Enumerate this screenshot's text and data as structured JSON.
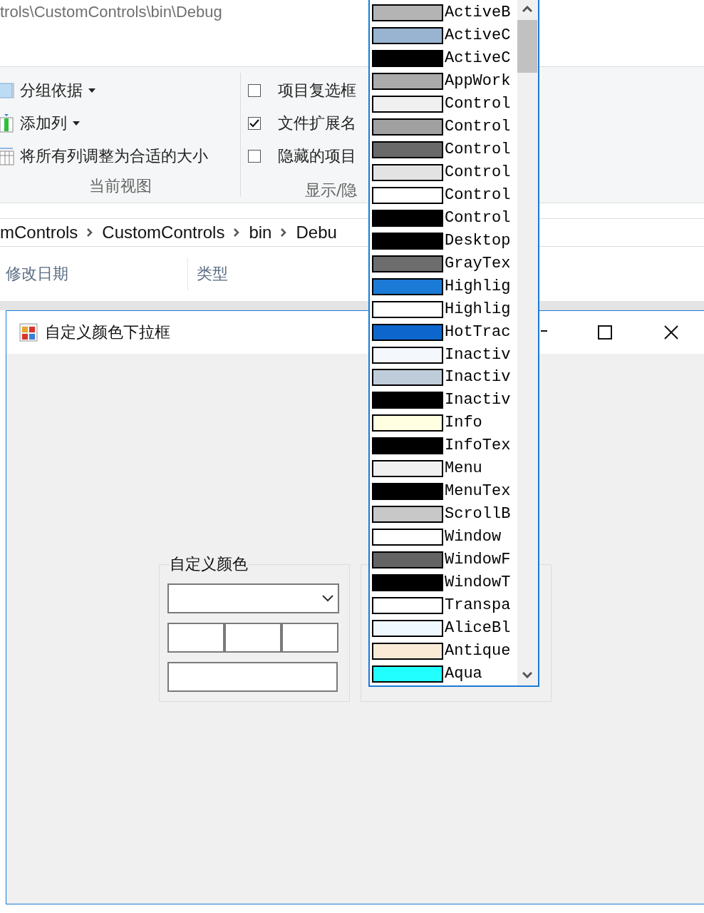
{
  "explorer": {
    "path_title": "trols\\CustomControls\\bin\\Debug",
    "ribbon": {
      "view_group": {
        "items": [
          {
            "kind": "group",
            "label": "分组依据",
            "dropdown": true
          },
          {
            "kind": "column",
            "label": "添加列",
            "dropdown": true
          },
          {
            "kind": "fit",
            "label": "将所有列调整为合适的大小",
            "dropdown": false
          }
        ],
        "label": "当前视图"
      },
      "show_group": {
        "items": [
          {
            "label": "项目复选框",
            "checked": false
          },
          {
            "label": "文件扩展名",
            "checked": true
          },
          {
            "label": "隐藏的项目",
            "checked": false
          }
        ],
        "label": "显示/隐"
      }
    },
    "breadcrumbs": [
      "mControls",
      "CustomControls",
      "bin",
      "Debu"
    ],
    "columns": [
      "修改日期",
      "类型"
    ]
  },
  "window": {
    "title": "自定义颜色下拉框",
    "group_box": {
      "label": "自定义颜色"
    }
  },
  "color_list": {
    "items": [
      {
        "name": "ActiveB",
        "color": "#b4b4b4"
      },
      {
        "name": "ActiveC",
        "color": "#99b4d1"
      },
      {
        "name": "ActiveC",
        "color": "#000000"
      },
      {
        "name": "AppWork",
        "color": "#ababab"
      },
      {
        "name": "Control",
        "color": "#f0f0f0"
      },
      {
        "name": "Control",
        "color": "#a0a0a0"
      },
      {
        "name": "Control",
        "color": "#696969"
      },
      {
        "name": "Control",
        "color": "#e3e3e3"
      },
      {
        "name": "Control",
        "color": "#ffffff"
      },
      {
        "name": "Control",
        "color": "#000000"
      },
      {
        "name": "Desktop",
        "color": "#000000"
      },
      {
        "name": "GrayTex",
        "color": "#6d6d6d"
      },
      {
        "name": "Highlig",
        "color": "#1a7ad6"
      },
      {
        "name": "Highlig",
        "color": "#ffffff"
      },
      {
        "name": "HotTrac",
        "color": "#0d66cc"
      },
      {
        "name": "Inactiv",
        "color": "#f4f7fc"
      },
      {
        "name": "Inactiv",
        "color": "#bfcddb"
      },
      {
        "name": "Inactiv",
        "color": "#000000"
      },
      {
        "name": "Info",
        "color": "#ffffe1"
      },
      {
        "name": "InfoTex",
        "color": "#000000"
      },
      {
        "name": "Menu",
        "color": "#f0f0f0"
      },
      {
        "name": "MenuTex",
        "color": "#000000"
      },
      {
        "name": "ScrollB",
        "color": "#c8c8c8"
      },
      {
        "name": "Window",
        "color": "#ffffff"
      },
      {
        "name": "WindowF",
        "color": "#646464"
      },
      {
        "name": "WindowT",
        "color": "#000000"
      },
      {
        "name": "Transpa",
        "color": "#ffffff"
      },
      {
        "name": "AliceBl",
        "color": "#f0f8ff"
      },
      {
        "name": "Antique",
        "color": "#faebd7"
      },
      {
        "name": "Aqua",
        "color": "#22ffff"
      }
    ]
  }
}
